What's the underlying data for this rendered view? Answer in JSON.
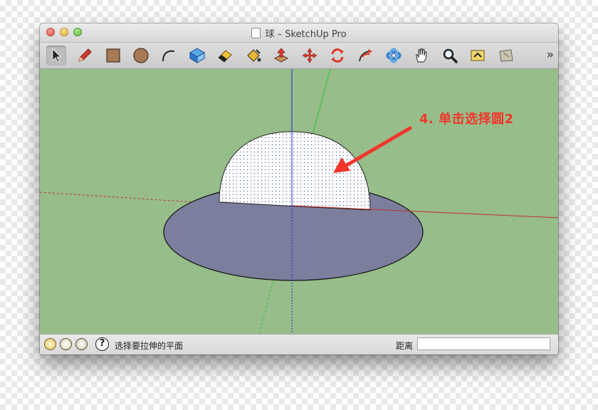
{
  "window": {
    "title": "球 – SketchUp Pro"
  },
  "toolbar": {
    "tools": [
      {
        "name": "select-tool",
        "icon": "arrow-cursor-icon"
      },
      {
        "name": "pencil-tool",
        "icon": "pencil-icon"
      },
      {
        "name": "rectangle-tool",
        "icon": "rectangle-icon"
      },
      {
        "name": "circle-tool",
        "icon": "circle-icon"
      },
      {
        "name": "arc-tool",
        "icon": "arc-icon"
      },
      {
        "name": "make-component-tool",
        "icon": "component-icon"
      },
      {
        "name": "eraser-tool",
        "icon": "eraser-icon"
      },
      {
        "name": "paint-bucket-tool",
        "icon": "paint-bucket-icon"
      },
      {
        "name": "push-pull-tool",
        "icon": "push-pull-icon"
      },
      {
        "name": "move-tool",
        "icon": "move-icon"
      },
      {
        "name": "rotate-tool",
        "icon": "rotate-icon"
      },
      {
        "name": "follow-me-tool",
        "icon": "follow-me-icon"
      },
      {
        "name": "orbit-tool",
        "icon": "orbit-icon"
      },
      {
        "name": "pan-tool",
        "icon": "hand-icon"
      },
      {
        "name": "zoom-tool",
        "icon": "magnifier-icon"
      },
      {
        "name": "zoom-extents-tool",
        "icon": "zoom-extents-icon"
      },
      {
        "name": "warehouse-tool",
        "icon": "warehouse-icon"
      }
    ],
    "overflow_label": "»"
  },
  "viewport": {
    "annotation": "4. 单击选择圆2"
  },
  "status": {
    "hint": "选择要拉伸的平面",
    "measure_label": "距离",
    "measure_value": ""
  },
  "colors": {
    "background_green": "#97bd8a",
    "disc_fill": "#7b7e9c",
    "annotation_red": "#f0362b",
    "axis_blue": "#1a2bd0",
    "axis_red": "#c0302a",
    "axis_green": "#2fbf3a"
  }
}
